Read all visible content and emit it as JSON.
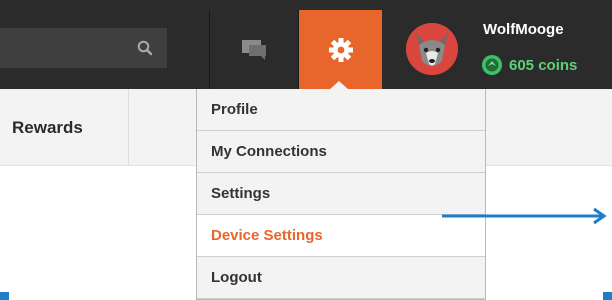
{
  "header": {
    "search": {
      "value": "",
      "placeholder": ""
    },
    "icons": {
      "search": "search-icon",
      "chat": "chat-icon",
      "gear": "gear-icon",
      "coin": "coin-icon"
    },
    "user": {
      "name": "WolfMooge",
      "coins": "605 coins"
    }
  },
  "subnav": {
    "items": [
      {
        "label": "Rewards"
      }
    ]
  },
  "settings_menu": {
    "items": [
      {
        "label": "Profile",
        "active": false
      },
      {
        "label": "My Connections",
        "active": false
      },
      {
        "label": "Settings",
        "active": false
      },
      {
        "label": "Device Settings",
        "active": true
      },
      {
        "label": "Logout",
        "active": false
      }
    ]
  },
  "colors": {
    "topbar": "#2b2b2b",
    "accent": "#e8662c",
    "coins": "#5fd07a",
    "annotation_arrow": "#1e7fc7"
  }
}
